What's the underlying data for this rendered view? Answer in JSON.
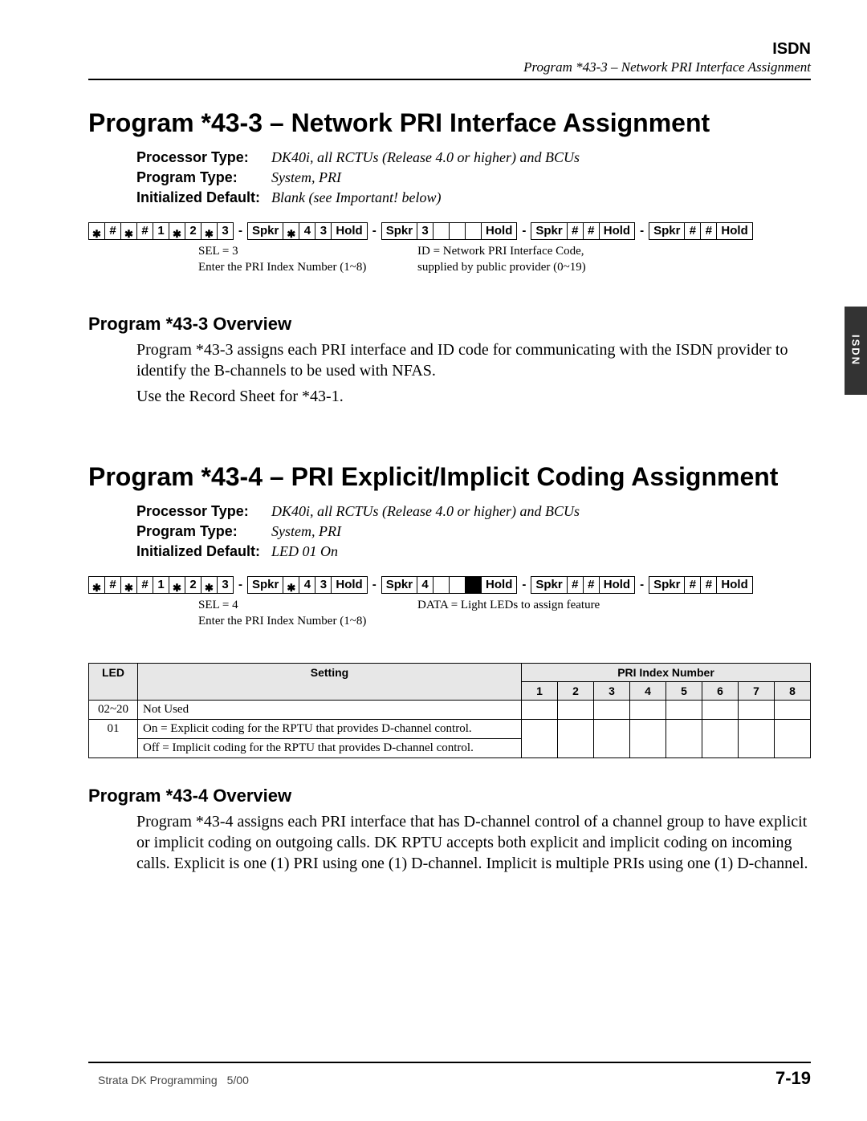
{
  "header": {
    "section": "ISDN",
    "subtitle": "Program *43-3 – Network PRI Interface Assignment"
  },
  "side_tab": "ISDN",
  "p433": {
    "title": "Program *43-3 – Network PRI Interface Assignment",
    "meta": {
      "processor_type_label": "Processor Type:",
      "processor_type": "DK40i, all RCTUs (Release 4.0 or higher) and BCUs",
      "program_type_label": "Program Type:",
      "program_type": "System, PRI",
      "init_default_label": "Initialized Default:",
      "init_default": "Blank (see Important! below)"
    },
    "keyseq": {
      "g1": [
        "✱",
        "#",
        "✱",
        "#",
        "1",
        "✱",
        "2",
        "✱",
        "3"
      ],
      "g2": [
        "Spkr",
        "✱",
        "4",
        "3",
        "Hold"
      ],
      "g3": [
        "Spkr",
        "3",
        " ",
        " ",
        " ",
        "Hold"
      ],
      "g4": [
        "Spkr",
        "#",
        "#",
        "Hold"
      ],
      "g5": [
        "Spkr",
        "#",
        "#",
        "Hold"
      ]
    },
    "anno": {
      "l1": "SEL = 3",
      "l2": "Enter the PRI Index Number (1~8)",
      "r1": "ID = Network PRI Interface Code,",
      "r2": "supplied by public provider (0~19)"
    },
    "overview_heading": "Program *43-3 Overview",
    "overview_p1": "Program *43-3 assigns each PRI interface and ID code for communicating with the ISDN provider to identify the B-channels to be used with NFAS.",
    "overview_p2": "Use the Record Sheet for *43-1."
  },
  "p434": {
    "title": "Program *43-4 –  PRI Explicit/Implicit Coding Assignment",
    "meta": {
      "processor_type_label": "Processor Type:",
      "processor_type": "DK40i, all RCTUs (Release 4.0 or higher) and BCUs",
      "program_type_label": "Program Type:",
      "program_type": "System, PRI",
      "init_default_label": "Initialized Default:",
      "init_default": "LED 01 On"
    },
    "keyseq": {
      "g1": [
        "✱",
        "#",
        "✱",
        "#",
        "1",
        "✱",
        "2",
        "✱",
        "3"
      ],
      "g2": [
        "Spkr",
        "✱",
        "4",
        "3",
        "Hold"
      ],
      "g3": [
        "Spkr",
        "4",
        " ",
        " ",
        "■",
        "Hold"
      ],
      "g4": [
        "Spkr",
        "#",
        "#",
        "Hold"
      ],
      "g5": [
        "Spkr",
        "#",
        "#",
        "Hold"
      ]
    },
    "anno": {
      "l1": "SEL = 4",
      "l2": "Enter the PRI Index Number (1~8)",
      "r1": "DATA = Light LEDs to assign feature",
      "r2": ""
    },
    "table": {
      "h_led": "LED",
      "h_setting": "Setting",
      "h_pri": "PRI Index Number",
      "cols": [
        "1",
        "2",
        "3",
        "4",
        "5",
        "6",
        "7",
        "8"
      ],
      "rows": [
        {
          "led": "02~20",
          "setting": "Not Used"
        },
        {
          "led": "01",
          "setting": "On = Explicit coding for the RPTU that provides D-channel control.\nOff = Implicit coding  for the RPTU that provides D-channel control."
        }
      ]
    },
    "overview_heading": "Program *43-4 Overview",
    "overview_p1": "Program *43-4 assigns each PRI interface that has D-channel control of a channel group to have explicit or implicit coding on outgoing calls. DK RPTU accepts both explicit and implicit coding on incoming calls. Explicit is one (1) PRI using one (1) D-channel. Implicit is multiple PRIs using one (1) D-channel."
  },
  "footer": {
    "left": "Strata DK Programming",
    "date": "5/00",
    "page": "7-19"
  }
}
